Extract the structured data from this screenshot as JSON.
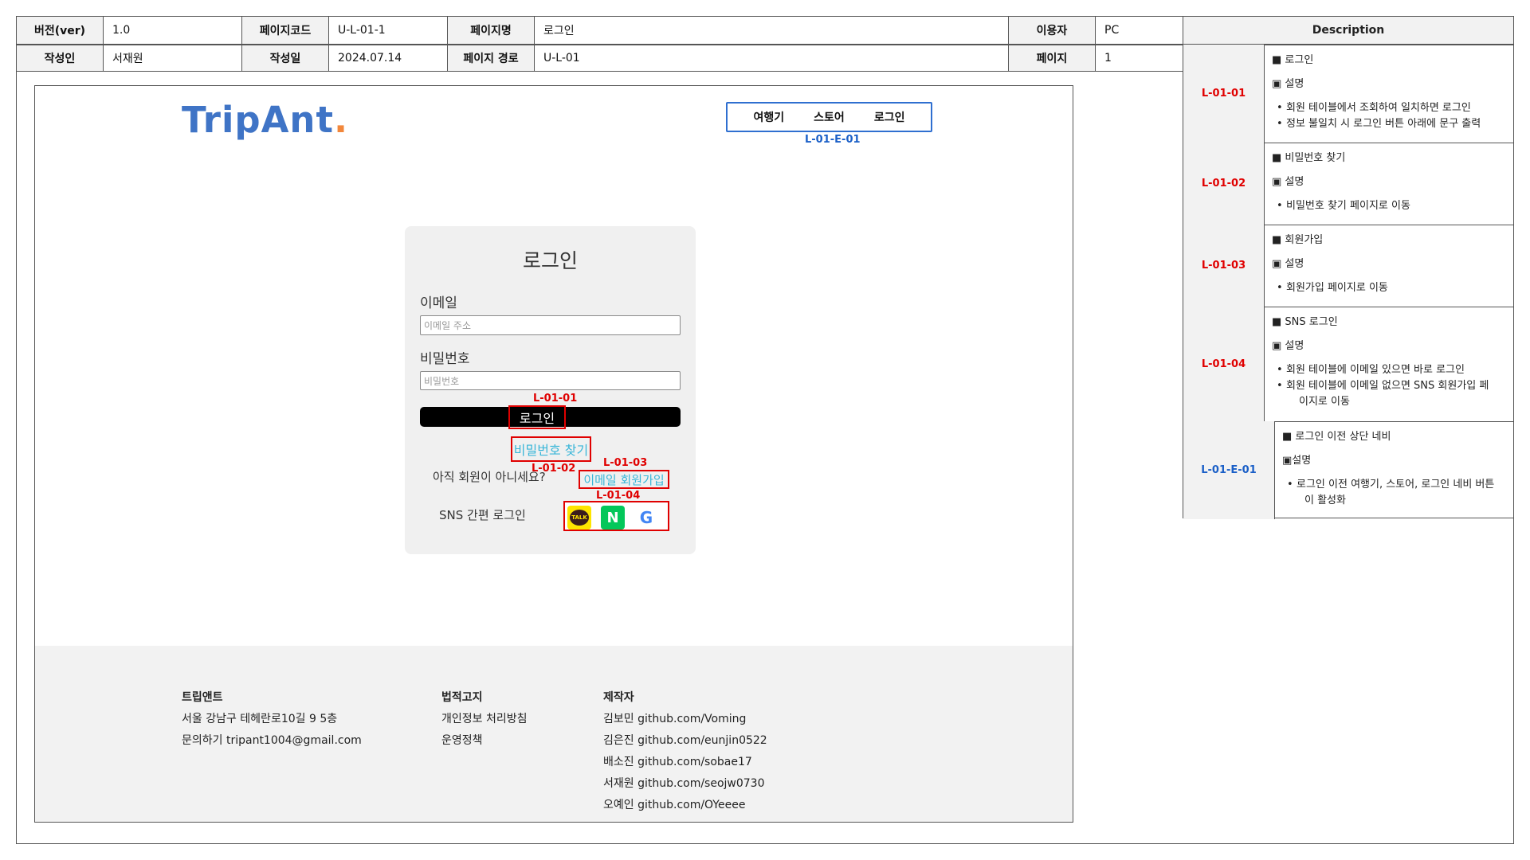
{
  "spec_header": {
    "version_label": "버전(ver)",
    "version": "1.0",
    "page_code_label": "페이지코드",
    "page_code": "U-L-01-1",
    "page_name_label": "페이지명",
    "page_name": "로그인",
    "user_label": "이용자",
    "user": "PC",
    "author_label": "작성인",
    "author": "서재원",
    "date_label": "작성일",
    "date": "2024.07.14",
    "path_label": "페이지 경로",
    "path": "U-L-01",
    "page_label": "페이지",
    "page": "1"
  },
  "site": {
    "logo_trip": "Trip",
    "logo_ant": "Ant",
    "logo_dot": ".",
    "nav": [
      "여행기",
      "스토어",
      "로그인"
    ],
    "nav_marker": "L-01-E-01"
  },
  "login": {
    "title": "로그인",
    "email_label": "이메일",
    "email_placeholder": "이메일 주소",
    "password_label": "비밀번호",
    "password_placeholder": "비밀번호",
    "button_label": "로그인",
    "find_password": "비밀번호 찾기",
    "not_member": "아직 회원이 아니세요?",
    "email_signup": "이메일 회원가입",
    "sns_label": "SNS 간편 로그인",
    "sns_icons": {
      "kakao": "TALK",
      "naver": "N",
      "google": "G"
    },
    "markers": {
      "login": "L-01-01",
      "find": "L-01-02",
      "signup": "L-01-03",
      "sns": "L-01-04"
    },
    "colors": {
      "kakao": "#fee500",
      "naver": "#03c75a",
      "link": "#39b6d8",
      "marker": "#e00000"
    }
  },
  "footer": {
    "company": {
      "title": "트립앤트",
      "lines": [
        "서울 강남구 테헤란로10길 9 5층",
        "문의하기 tripant1004@gmail.com"
      ]
    },
    "legal": {
      "title": "법적고지",
      "lines": [
        "개인정보 처리방침",
        "운영정책"
      ]
    },
    "makers": {
      "title": "제작자",
      "lines": [
        "김보민 github.com/Voming",
        "김은진 github.com/eunjin0522",
        "배소진 github.com/sobae17",
        "서재원 github.com/seojw0730",
        "오예인 github.com/OYeeee"
      ]
    }
  },
  "description": {
    "title": "Description",
    "rows": [
      {
        "id": "L-01-01",
        "heading": "■ 로그인",
        "sub": "▣ 설명",
        "bullets": [
          "회원 테이블에서 조회하여 일치하면 로그인",
          "정보 불일치 시 로그인 버튼 아래에 문구 출력"
        ]
      },
      {
        "id": "L-01-02",
        "heading": "■ 비밀번호 찾기",
        "sub": "▣ 설명",
        "bullets": [
          "비밀번호 찾기 페이지로 이동"
        ]
      },
      {
        "id": "L-01-03",
        "heading": "■ 회원가입",
        "sub": "▣ 설명",
        "bullets": [
          "회원가입 페이지로 이동"
        ]
      },
      {
        "id": "L-01-04",
        "heading": "■ SNS 로그인",
        "sub": "▣ 설명",
        "bullets": [
          "회원 테이블에 이메일 있으면 바로 로그인",
          "회원 테이블에 이메일 없으면 SNS 회원가입 페",
          "이지로 이동"
        ]
      },
      {
        "id": "L-01-E-01",
        "heading": "■ 로그인 이전 상단 네비",
        "sub": "▣설명",
        "bullets": [
          "로그인 이전 여행기, 스토어, 로그인 네비 버튼",
          "이 활성화"
        ]
      }
    ],
    "id_colors": {
      "red": "#e00000",
      "blue": "#1a5fc7"
    }
  }
}
